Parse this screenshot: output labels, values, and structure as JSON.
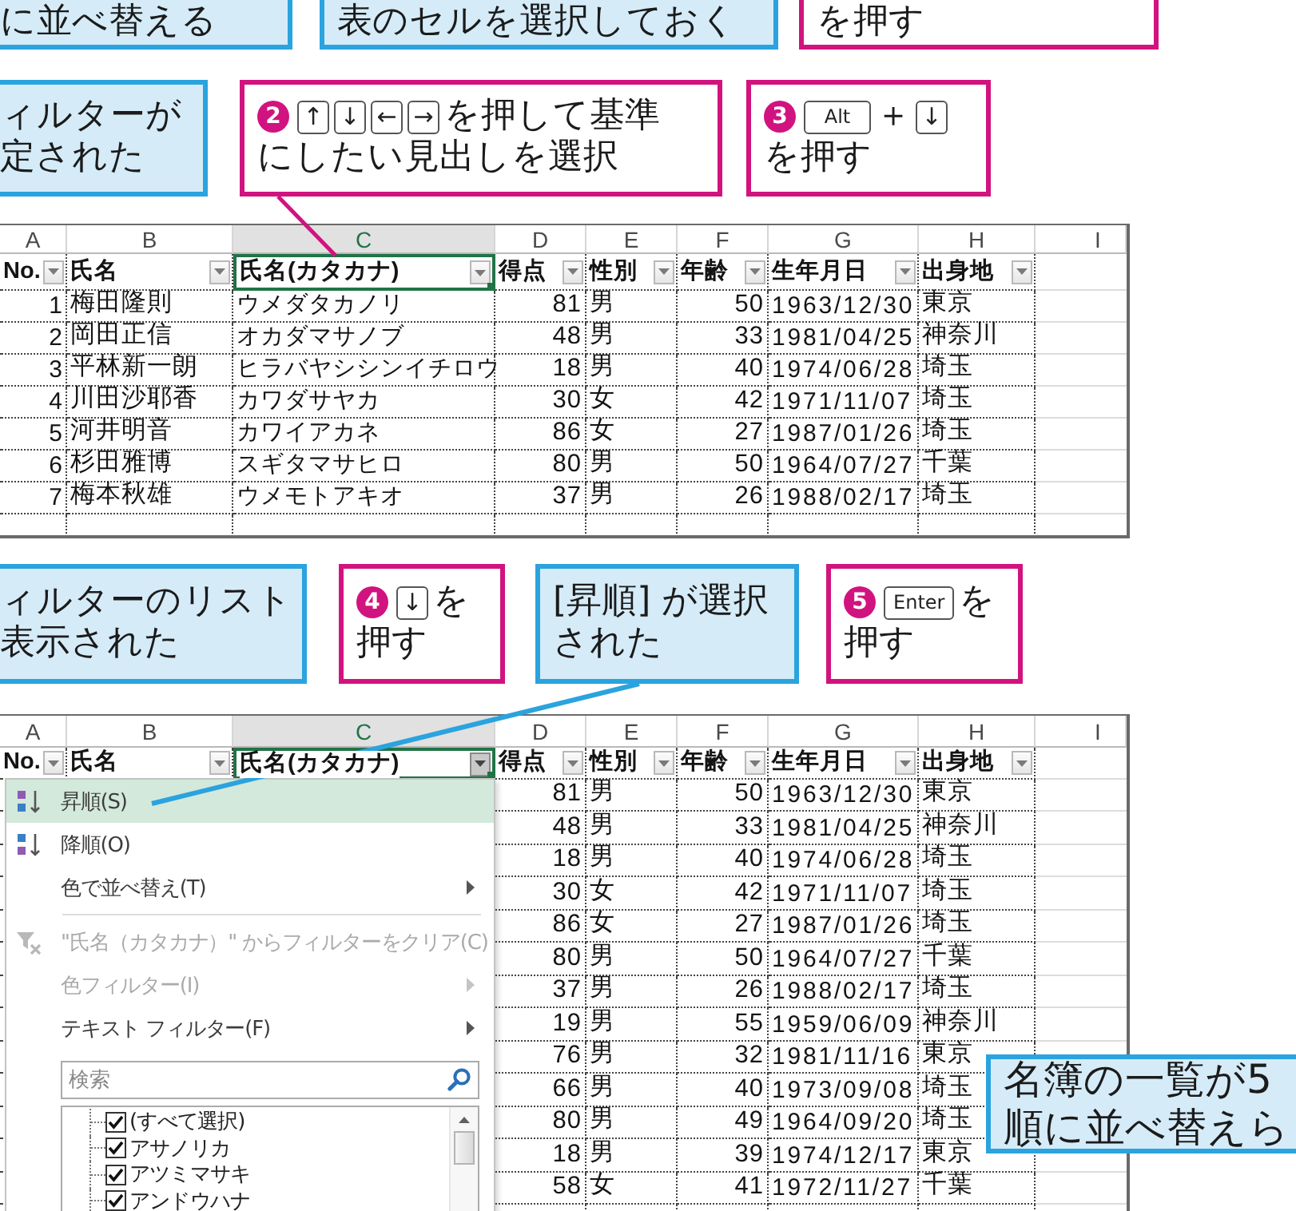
{
  "top_callouts": [
    {
      "kind": "note",
      "lines": [
        [
          {
            "kind": "text",
            "text": "に並べ替える"
          }
        ]
      ]
    },
    {
      "kind": "note",
      "lines": [
        [
          {
            "kind": "text",
            "text": "表のセルを選択しておく"
          }
        ]
      ]
    },
    {
      "kind": "step",
      "lines": [
        [
          {
            "kind": "text",
            "text": "を押す"
          }
        ]
      ]
    }
  ],
  "upper_callouts": [
    {
      "kind": "note",
      "lines": [
        [
          {
            "kind": "text",
            "text": "ィルターが"
          }
        ],
        [
          {
            "kind": "text",
            "text": "定された"
          }
        ]
      ]
    },
    {
      "kind": "step",
      "lines": [
        [
          {
            "kind": "badge",
            "text": "2"
          },
          {
            "kind": "key",
            "text": "↑"
          },
          {
            "kind": "key",
            "text": "↓"
          },
          {
            "kind": "key",
            "text": "←"
          },
          {
            "kind": "key",
            "text": "→"
          },
          {
            "kind": "text",
            "text": "を押して基準"
          }
        ],
        [
          {
            "kind": "text",
            "text": "にしたい見出しを選択"
          }
        ]
      ]
    },
    {
      "kind": "step",
      "lines": [
        [
          {
            "kind": "badge",
            "text": "3"
          },
          {
            "kind": "key",
            "text": "Alt"
          },
          {
            "kind": "text",
            "text": "＋"
          },
          {
            "kind": "key",
            "text": "↓"
          }
        ],
        [
          {
            "kind": "text",
            "text": "を押す"
          }
        ]
      ]
    }
  ],
  "sheet_before": {
    "column_letters": [
      {
        "label": "A",
        "selected": false
      },
      {
        "label": "B",
        "selected": false
      },
      {
        "label": "C",
        "selected": true
      },
      {
        "label": "D",
        "selected": false
      },
      {
        "label": "E",
        "selected": false
      },
      {
        "label": "F",
        "selected": false
      },
      {
        "label": "G",
        "selected": false
      },
      {
        "label": "H",
        "selected": false
      },
      {
        "label": "I",
        "selected": false
      }
    ],
    "headers": [
      {
        "label": "No.",
        "selected": false
      },
      {
        "label": "氏名",
        "selected": false
      },
      {
        "label": "氏名(カタカナ)",
        "selected": true
      },
      {
        "label": "得点",
        "selected": false
      },
      {
        "label": "性別",
        "selected": false
      },
      {
        "label": "年齢",
        "selected": false
      },
      {
        "label": "生年月日",
        "selected": false
      },
      {
        "label": "出身地",
        "selected": false
      }
    ],
    "rows": [
      {
        "no": "1",
        "name": "梅田隆則",
        "kana": "ウメダタカノリ",
        "score": "81",
        "sex": "男",
        "age": "50",
        "birth": "1963/12/30",
        "home": "東京"
      },
      {
        "no": "2",
        "name": "岡田正信",
        "kana": "オカダマサノブ",
        "score": "48",
        "sex": "男",
        "age": "33",
        "birth": "1981/04/25",
        "home": "神奈川"
      },
      {
        "no": "3",
        "name": "平林新一朗",
        "kana": "ヒラバヤシシンイチロウ",
        "score": "18",
        "sex": "男",
        "age": "40",
        "birth": "1974/06/28",
        "home": "埼玉"
      },
      {
        "no": "4",
        "name": "川田沙耶香",
        "kana": "カワダサヤカ",
        "score": "30",
        "sex": "女",
        "age": "42",
        "birth": "1971/11/07",
        "home": "埼玉"
      },
      {
        "no": "5",
        "name": "河井明音",
        "kana": "カワイアカネ",
        "score": "86",
        "sex": "女",
        "age": "27",
        "birth": "1987/01/26",
        "home": "埼玉"
      },
      {
        "no": "6",
        "name": "杉田雅博",
        "kana": "スギタマサヒロ",
        "score": "80",
        "sex": "男",
        "age": "50",
        "birth": "1964/07/27",
        "home": "千葉"
      },
      {
        "no": "7",
        "name": "梅本秋雄",
        "kana": "ウメモトアキオ",
        "score": "37",
        "sex": "男",
        "age": "26",
        "birth": "1988/02/17",
        "home": "埼玉"
      }
    ]
  },
  "lower_callouts": [
    {
      "kind": "note",
      "lines": [
        [
          {
            "kind": "text",
            "text": "ィルターのリスト"
          }
        ],
        [
          {
            "kind": "text",
            "text": "表示された"
          }
        ]
      ]
    },
    {
      "kind": "step",
      "lines": [
        [
          {
            "kind": "badge",
            "text": "4"
          },
          {
            "kind": "key",
            "text": "↓"
          },
          {
            "kind": "text",
            "text": "を"
          }
        ],
        [
          {
            "kind": "text",
            "text": "押す"
          }
        ]
      ]
    },
    {
      "kind": "note",
      "lines": [
        [
          {
            "kind": "text",
            "text": "[昇順] が選択"
          }
        ],
        [
          {
            "kind": "text",
            "text": "された"
          }
        ]
      ]
    },
    {
      "kind": "step",
      "lines": [
        [
          {
            "kind": "badge",
            "text": "5"
          },
          {
            "kind": "key",
            "text": "Enter"
          },
          {
            "kind": "text",
            "text": "を"
          }
        ],
        [
          {
            "kind": "text",
            "text": "押す"
          }
        ]
      ]
    }
  ],
  "sheet_after": {
    "column_letters": [
      {
        "label": "A",
        "selected": false
      },
      {
        "label": "B",
        "selected": false
      },
      {
        "label": "C",
        "selected": true
      },
      {
        "label": "D",
        "selected": false
      },
      {
        "label": "E",
        "selected": false
      },
      {
        "label": "F",
        "selected": false
      },
      {
        "label": "G",
        "selected": false
      },
      {
        "label": "H",
        "selected": false
      },
      {
        "label": "I",
        "selected": false
      }
    ],
    "headers": [
      {
        "label": "No.",
        "selected": false,
        "filter_open": false
      },
      {
        "label": "氏名",
        "selected": false,
        "filter_open": false
      },
      {
        "label": "氏名(カタカナ)",
        "selected": true,
        "filter_open": true
      },
      {
        "label": "得点",
        "selected": false,
        "filter_open": false
      },
      {
        "label": "性別",
        "selected": false,
        "filter_open": false
      },
      {
        "label": "年齢",
        "selected": false,
        "filter_open": false
      },
      {
        "label": "生年月日",
        "selected": false,
        "filter_open": false
      },
      {
        "label": "出身地",
        "selected": false,
        "filter_open": false
      }
    ],
    "rows": [
      {
        "score": "81",
        "sex": "男",
        "age": "50",
        "birth": "1963/12/30",
        "home": "東京"
      },
      {
        "score": "48",
        "sex": "男",
        "age": "33",
        "birth": "1981/04/25",
        "home": "神奈川"
      },
      {
        "score": "18",
        "sex": "男",
        "age": "40",
        "birth": "1974/06/28",
        "home": "埼玉"
      },
      {
        "score": "30",
        "sex": "女",
        "age": "42",
        "birth": "1971/11/07",
        "home": "埼玉"
      },
      {
        "score": "86",
        "sex": "女",
        "age": "27",
        "birth": "1987/01/26",
        "home": "埼玉"
      },
      {
        "score": "80",
        "sex": "男",
        "age": "50",
        "birth": "1964/07/27",
        "home": "千葉"
      },
      {
        "score": "37",
        "sex": "男",
        "age": "26",
        "birth": "1988/02/17",
        "home": "埼玉"
      },
      {
        "score": "19",
        "sex": "男",
        "age": "55",
        "birth": "1959/06/09",
        "home": "神奈川"
      },
      {
        "score": "76",
        "sex": "男",
        "age": "32",
        "birth": "1981/11/16",
        "home": "東京"
      },
      {
        "score": "66",
        "sex": "男",
        "age": "40",
        "birth": "1973/09/08",
        "home": "埼玉"
      },
      {
        "score": "80",
        "sex": "男",
        "age": "49",
        "birth": "1964/09/20",
        "home": "埼玉"
      },
      {
        "score": "18",
        "sex": "男",
        "age": "39",
        "birth": "1974/12/17",
        "home": "東京"
      },
      {
        "score": "58",
        "sex": "女",
        "age": "41",
        "birth": "1972/11/27",
        "home": "千葉"
      }
    ],
    "filter_menu": {
      "sections": [
        {
          "items": [
            {
              "label": "昇順(S)",
              "kind": "sort_ascending",
              "selected": true,
              "disabled": false,
              "submenu": false
            },
            {
              "label": "降順(O)",
              "kind": "sort_descending",
              "selected": false,
              "disabled": false,
              "submenu": false
            },
            {
              "label": "色で並べ替え(T)",
              "kind": "plain",
              "selected": false,
              "disabled": false,
              "submenu": true
            }
          ]
        },
        {
          "items": [
            {
              "label": "\"氏名（カタカナ）\" からフィルターをクリア(C)",
              "kind": "clear_filter",
              "selected": false,
              "disabled": true,
              "submenu": false
            },
            {
              "label": "色フィルター(I)",
              "kind": "plain",
              "selected": false,
              "disabled": true,
              "submenu": true
            },
            {
              "label": "テキスト フィルター(F)",
              "kind": "plain",
              "selected": false,
              "disabled": false,
              "submenu": true
            }
          ]
        }
      ],
      "search": {
        "placeholder": "検索"
      },
      "checklist": [
        {
          "label": "(すべて選択)",
          "checked": true
        },
        {
          "label": "アサノリカ",
          "checked": true
        },
        {
          "label": "アツミマサキ",
          "checked": true
        },
        {
          "label": "アンドウハナ",
          "checked": true
        }
      ]
    },
    "result_callout": {
      "kind": "note",
      "lines": [
        [
          {
            "kind": "text",
            "text": "名簿の一覧が5"
          }
        ],
        [
          {
            "kind": "text",
            "text": "順に並べ替えら"
          }
        ]
      ]
    }
  }
}
